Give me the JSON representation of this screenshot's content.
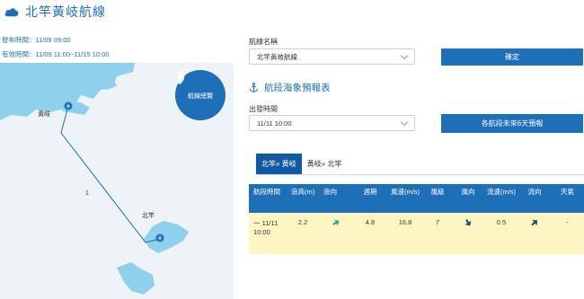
{
  "header": {
    "title": "北竿黃岐航線",
    "issue_time": "發布時間：11/09 09:00",
    "valid_time": "有效時間：11/09 11:00~11/15 10:00"
  },
  "map": {
    "button_label": "航線總覽",
    "labels": {
      "huangqi": "黃岐",
      "beigan": "北竿",
      "route_number": "1"
    }
  },
  "route_select": {
    "label": "航線名稱",
    "value": "北竿黃岐航線",
    "confirm_label": "確定"
  },
  "forecast_section": {
    "title": "航段海象預報表",
    "depart_label": "出發時間",
    "depart_value": "11/11 10:00",
    "six_day_label": "各航段未來6天預報"
  },
  "tabs": [
    {
      "label": "北竿» 黃岐",
      "active": true
    },
    {
      "label": "黃岐» 北竿",
      "active": false
    }
  ],
  "table": {
    "headers": [
      "航段時間",
      "浪高(m)",
      "浪向",
      "週期",
      "風速(m/s)",
      "風級",
      "風向",
      "流速(m/s)",
      "流向",
      "天氣"
    ],
    "row": {
      "time": "一 11/11 10:00",
      "wave_height": "2.2",
      "wave_dir_icon": "wave-direction-arrow-icon",
      "period": "4.8",
      "wind_speed": "16.8",
      "wind_level": "7",
      "wind_dir_icon": "wind-direction-arrow-icon",
      "current_speed": "0.5",
      "current_dir_icon": "current-direction-arrow-icon",
      "weather": "-"
    }
  },
  "colors": {
    "primary": "#1d6fb8",
    "tab_active": "#0f5aa3",
    "table_row": "#fdf6c3",
    "sea": "#eef3f8",
    "land": "#8fd0ec",
    "wave_arrow": "#2aa3a3"
  }
}
